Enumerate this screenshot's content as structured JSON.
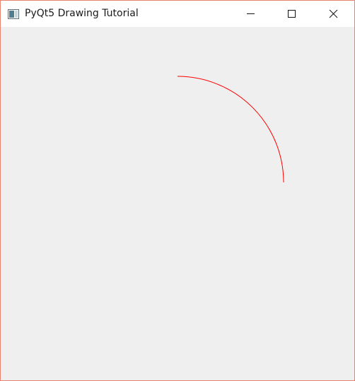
{
  "window": {
    "title": "PyQt5 Drawing Tutorial",
    "icon": "window-app-icon",
    "controls": {
      "minimize_icon": "minimize-icon",
      "maximize_icon": "maximize-icon",
      "close_icon": "close-icon"
    },
    "border_color": "#e8836f"
  },
  "canvas": {
    "background": "#efefef",
    "arc": {
      "color": "#ff0000",
      "icon": "red-arc"
    }
  }
}
